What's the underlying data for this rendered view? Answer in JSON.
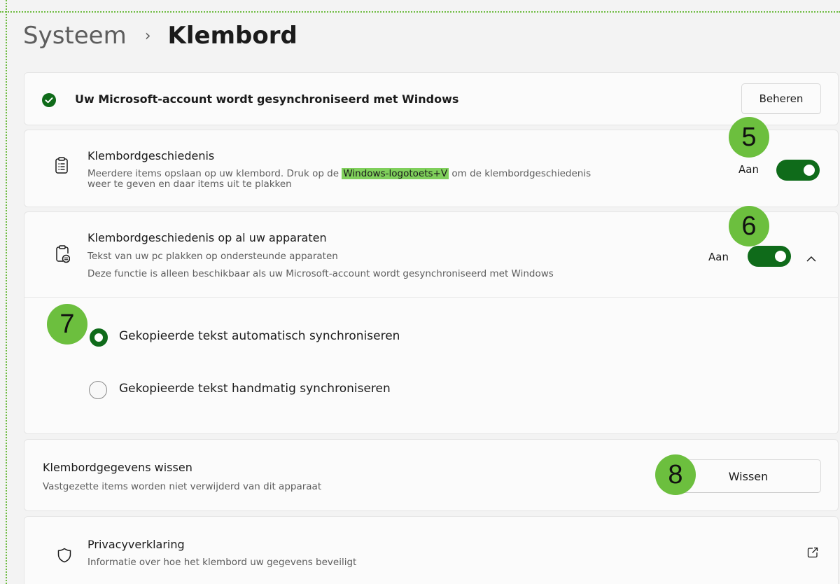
{
  "breadcrumb": {
    "parent": "Systeem",
    "separator": "›",
    "current": "Klembord"
  },
  "sync_banner": {
    "text": "Uw Microsoft-account wordt gesynchroniseerd met Windows",
    "button": "Beheren",
    "icon": "check-circle-icon"
  },
  "history": {
    "title": "Klembordgeschiedenis",
    "desc_before": "Meerdere items opslaan op uw klembord. Druk op de ",
    "desc_highlight": "Windows-logotoets+V",
    "desc_after": " om de klembordgeschiedenis",
    "desc_line2": "weer te geven en daar items uit te plakken",
    "toggle_label": "Aan",
    "toggle_on": true,
    "icon": "clipboard-list-icon",
    "badge": "5"
  },
  "devices": {
    "title": "Klembordgeschiedenis op al uw apparaten",
    "desc1": "Tekst van uw pc plakken op ondersteunde apparaten",
    "desc2": "Deze functie is alleen beschikbaar als uw Microsoft-account wordt gesynchroniseerd met Windows",
    "toggle_label": "Aan",
    "toggle_on": true,
    "icon": "clipboard-sync-icon",
    "badge": "6",
    "chevron": "^",
    "options": [
      {
        "label": "Gekopieerde tekst automatisch synchroniseren",
        "selected": true
      },
      {
        "label": "Gekopieerde tekst handmatig synchroniseren",
        "selected": false
      }
    ],
    "options_badge": "7"
  },
  "clear": {
    "title": "Klembordgegevens wissen",
    "desc": "Vastgezette items worden niet verwijderd van dit apparaat",
    "button": "Wissen",
    "badge": "8"
  },
  "privacy": {
    "title": "Privacyverklaring",
    "desc": "Informatie over hoe het klembord uw gegevens beveiligt",
    "icon": "shield-icon",
    "link_icon": "external-link-icon"
  },
  "colors": {
    "accent": "#0f6b1a",
    "badge": "#6cbf3e",
    "highlight": "#7fcf5b",
    "frame": "#6dbb3f"
  }
}
